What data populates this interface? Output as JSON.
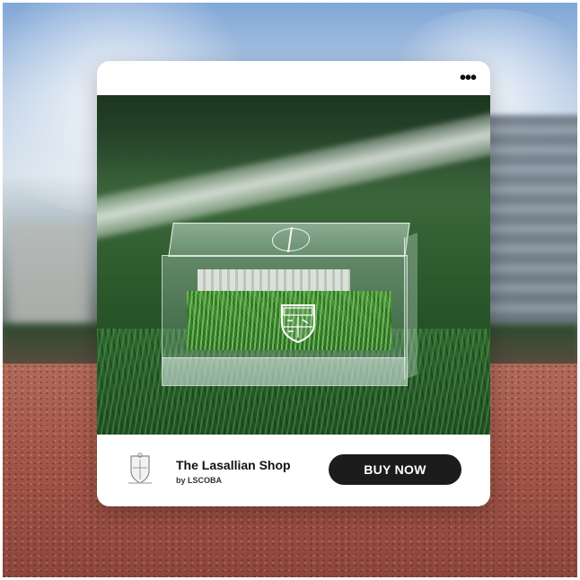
{
  "post": {
    "more_menu_icon": "more-horizontal-icon",
    "more_label": "•••"
  },
  "product": {
    "image_alt": "Acrylic cube with turf and La Salle crest",
    "crest_text": "LA SALLE"
  },
  "shop": {
    "name": "The Lasallian Shop",
    "by": "by LSCOBA",
    "logo_icon": "shop-crest-logo-icon"
  },
  "cta": {
    "label": "BUY NOW"
  },
  "colors": {
    "button_bg": "#1c1c1c",
    "button_text": "#ffffff",
    "card_bg": "#ffffff",
    "track": "#a45749",
    "turf": "#2f6a2f"
  }
}
